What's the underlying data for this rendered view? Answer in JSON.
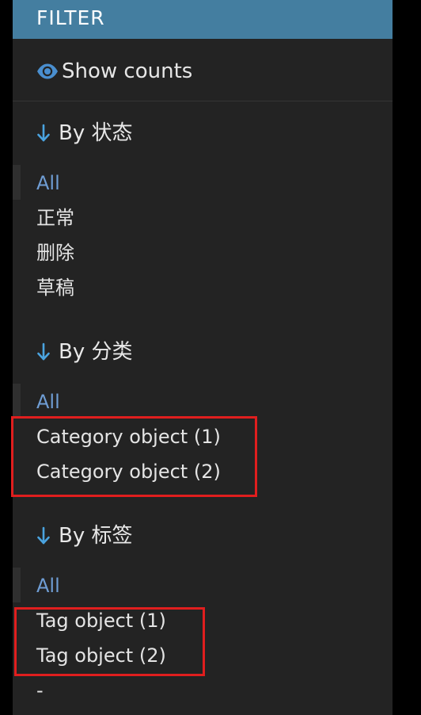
{
  "header": {
    "title": "FILTER"
  },
  "show_counts": {
    "label": "Show counts",
    "icon": "eye-icon"
  },
  "sections": [
    {
      "heading": "By 状态",
      "items": [
        {
          "label": "All",
          "active": true
        },
        {
          "label": "正常"
        },
        {
          "label": "删除"
        },
        {
          "label": "草稿"
        }
      ]
    },
    {
      "heading": "By 分类",
      "items": [
        {
          "label": "All",
          "active": true
        },
        {
          "label": "Category object (1)"
        },
        {
          "label": "Category object (2)"
        }
      ]
    },
    {
      "heading": "By 标签",
      "items": [
        {
          "label": "All",
          "active": true
        },
        {
          "label": "Tag object (1)"
        },
        {
          "label": "Tag object (2)"
        },
        {
          "label": "-"
        }
      ]
    }
  ],
  "colors": {
    "panel_bg": "#232323",
    "header_bg": "#447ea0",
    "active_item": "#6f9dd4",
    "arrow_icon": "#4aa3df",
    "highlight_border": "#e01e1e"
  }
}
